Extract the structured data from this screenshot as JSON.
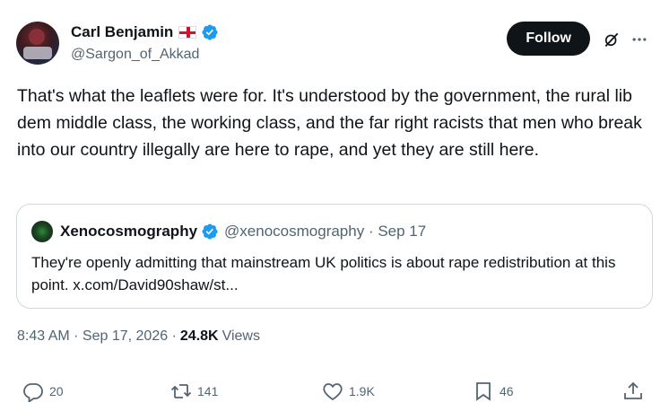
{
  "author": {
    "display_name": "Carl Benjamin",
    "handle": "@Sargon_of_Akkad",
    "flag_icon": "england-flag-icon",
    "verified_icon": "verified-badge-icon"
  },
  "header_actions": {
    "follow_label": "Follow",
    "grok_icon": "grok-icon",
    "more_icon": "more-icon"
  },
  "tweet": {
    "text": "That's what the leaflets were for. It's understood by the government, the rural lib dem middle class, the working class, and the far right racists that men who break into our country illegally are here to rape, and yet they are still here."
  },
  "quote": {
    "display_name": "Xenocosmography",
    "handle_date": "@xenocosmography · Sep 17",
    "text": "They're openly admitting that mainstream UK politics is about rape redistribution at this point. x.com/David90shaw/st..."
  },
  "meta": {
    "time_date": "8:43 AM · Sep 17, 2026 ·",
    "views_count": "24.8K",
    "views_label": "Views"
  },
  "actions": {
    "replies": "20",
    "retweets": "141",
    "likes": "1.9K",
    "bookmarks": "46"
  },
  "colors": {
    "text": "#0f1419",
    "secondary": "#536471",
    "verified": "#1d9bf0",
    "border": "#cfd9de"
  }
}
